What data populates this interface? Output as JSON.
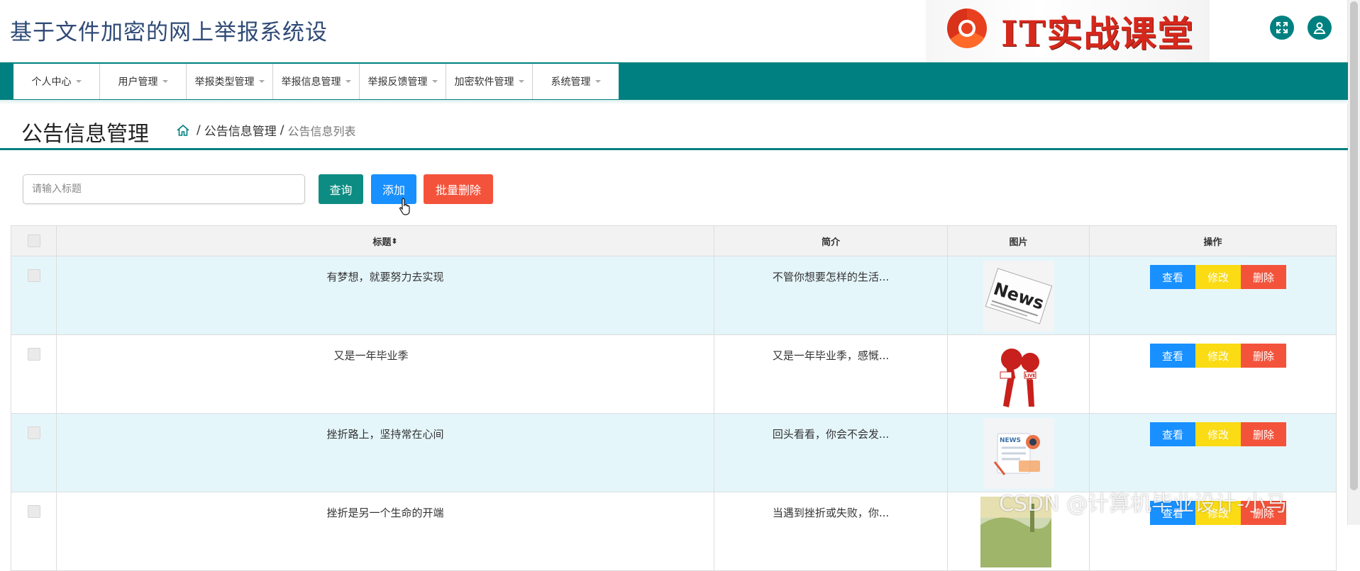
{
  "header": {
    "title": "基于文件加密的网上举报系统设",
    "brand_text": "IT实战课堂"
  },
  "nav": {
    "items": [
      {
        "label": "个人中心"
      },
      {
        "label": "用户管理"
      },
      {
        "label": "举报类型管理"
      },
      {
        "label": "举报信息管理"
      },
      {
        "label": "举报反馈管理"
      },
      {
        "label": "加密软件管理"
      },
      {
        "label": "系统管理"
      }
    ]
  },
  "page": {
    "title": "公告信息管理",
    "breadcrumb": {
      "section": "公告信息管理",
      "current": "公告信息列表",
      "sep": "/"
    }
  },
  "toolbar": {
    "search_placeholder": "请输入标题",
    "query_label": "查询",
    "add_label": "添加",
    "batch_delete_label": "批量删除"
  },
  "table": {
    "headers": {
      "title": "标题",
      "title_sort": "⬍",
      "intro": "简介",
      "image": "图片",
      "actions": "操作"
    },
    "rows": [
      {
        "title": "有梦想，就要努力去实现",
        "intro": "不管你想要怎样的生活...",
        "image": "news-newspaper"
      },
      {
        "title": "又是一年毕业季",
        "intro": "又是一年毕业季，感慨...",
        "image": "news-microphones"
      },
      {
        "title": "挫折路上，坚持常在心间",
        "intro": "回头看看，你会不会发...",
        "image": "news-illustration"
      },
      {
        "title": "挫折是另一个生命的开端",
        "intro": "当遇到挫折或失败，你...",
        "image": "landscape-photo"
      }
    ],
    "action_labels": {
      "view": "查看",
      "edit": "修改",
      "delete": "删除"
    }
  },
  "watermark": "CSDN @计算机毕业设计-小马",
  "colors": {
    "primary": "#008080",
    "blue": "#1890ff",
    "yellow": "#fadb14",
    "red": "#f4533b",
    "row_alt": "#e5f6fb"
  }
}
